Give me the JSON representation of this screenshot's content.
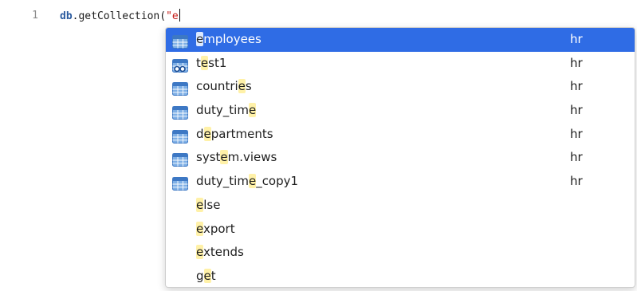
{
  "editor": {
    "line_number": "1",
    "code": {
      "obj": "db",
      "dot": ".",
      "method": "getCollection(",
      "string": "\"e"
    }
  },
  "autocomplete": {
    "selected_index": 0,
    "items": [
      {
        "parts": [
          [
            "e",
            true
          ],
          [
            "mployees",
            false
          ]
        ],
        "type": "hr",
        "icon": "table-icon"
      },
      {
        "parts": [
          [
            "t",
            false
          ],
          [
            "e",
            true
          ],
          [
            "st1",
            false
          ]
        ],
        "type": "hr",
        "icon": "view-icon"
      },
      {
        "parts": [
          [
            "countri",
            false
          ],
          [
            "e",
            true
          ],
          [
            "s",
            false
          ]
        ],
        "type": "hr",
        "icon": "table-icon"
      },
      {
        "parts": [
          [
            "duty_tim",
            false
          ],
          [
            "e",
            true
          ]
        ],
        "type": "hr",
        "icon": "table-icon"
      },
      {
        "parts": [
          [
            "d",
            false
          ],
          [
            "e",
            true
          ],
          [
            "partments",
            false
          ]
        ],
        "type": "hr",
        "icon": "table-icon"
      },
      {
        "parts": [
          [
            "syst",
            false
          ],
          [
            "e",
            true
          ],
          [
            "m.views",
            false
          ]
        ],
        "type": "hr",
        "icon": "table-icon"
      },
      {
        "parts": [
          [
            "duty_tim",
            false
          ],
          [
            "e",
            true
          ],
          [
            "_copy1",
            false
          ]
        ],
        "type": "hr",
        "icon": "table-icon"
      },
      {
        "parts": [
          [
            "e",
            true
          ],
          [
            "lse",
            false
          ]
        ],
        "type": "",
        "icon": ""
      },
      {
        "parts": [
          [
            "e",
            true
          ],
          [
            "xport",
            false
          ]
        ],
        "type": "",
        "icon": ""
      },
      {
        "parts": [
          [
            "e",
            true
          ],
          [
            "xtends",
            false
          ]
        ],
        "type": "",
        "icon": ""
      },
      {
        "parts": [
          [
            "g",
            false
          ],
          [
            "e",
            true
          ],
          [
            "t",
            false
          ]
        ],
        "type": "",
        "icon": ""
      }
    ]
  }
}
